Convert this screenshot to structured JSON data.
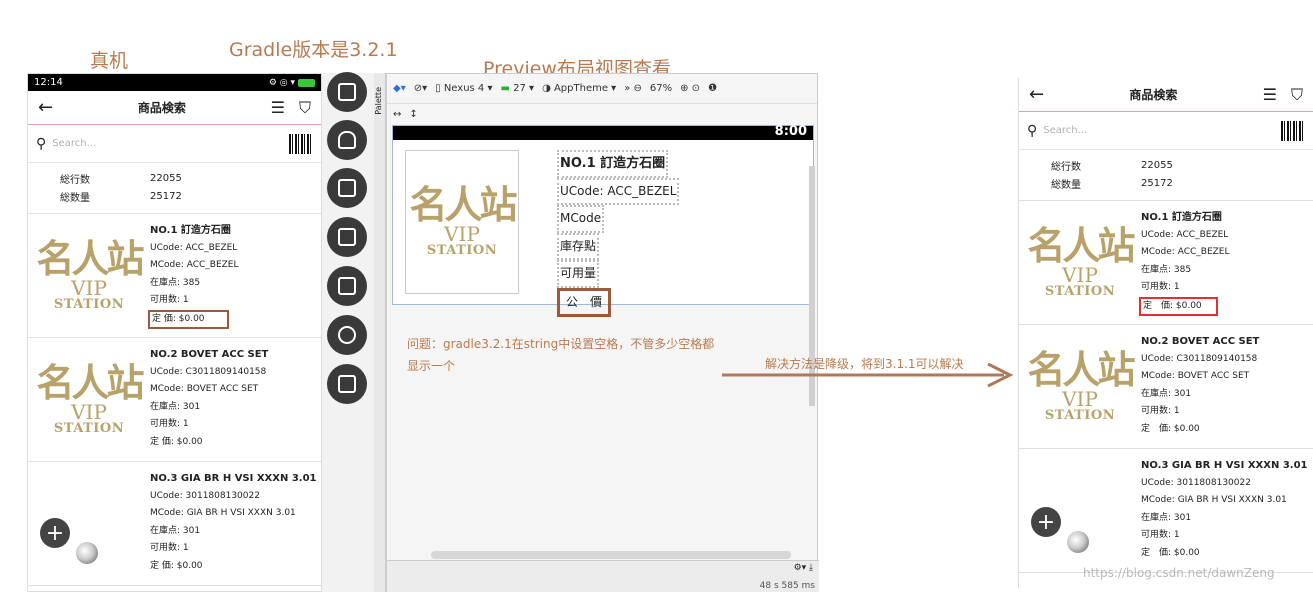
{
  "annotations": {
    "real_device": "真机",
    "gradle_version": "Gradle版本是3.2.1",
    "preview": "Preview布局视图查看",
    "problem_line1": "问题：gradle3.2.1在string中设置空格，不管多少空格都",
    "problem_line2": "显示一个",
    "solution": "解决方法是降级，将到3.1.1可以解决",
    "watermark": "https://blog.csdn.net/dawnZeng"
  },
  "status_bar": {
    "time": "12:14",
    "right": "⚙ ◎ ▾"
  },
  "app": {
    "title": "商品検索",
    "search_placeholder": "Search...",
    "totals": [
      {
        "label": "総行数",
        "value": "22055"
      },
      {
        "label": "総数量",
        "value": "25172"
      }
    ]
  },
  "logo": {
    "top": "名人站",
    "mid": "VIP",
    "bottom": "STATION"
  },
  "left_items": [
    {
      "name": "NO.1 訂造方石圈",
      "ucode": "UCode: ACC_BEZEL",
      "mcode": "MCode: ACC_BEZEL",
      "stock": "在庫点: 385",
      "avail": "可用数: 1",
      "price": "定 価: $0.00"
    },
    {
      "name": "NO.2 BOVET ACC SET",
      "ucode": "UCode: C3011809140158",
      "mcode": "MCode: BOVET ACC SET",
      "stock": "在庫点: 301",
      "avail": "可用数: 1",
      "price": "定 価: $0.00"
    },
    {
      "name": "NO.3 GIA BR H VSI XXXN 3.01",
      "ucode": "UCode: 3011808130022",
      "mcode": "MCode: GIA BR H VSI XXXN 3.01",
      "stock": "在庫点: 301",
      "avail": "可用数: 1",
      "price": "定 価: $0.00"
    }
  ],
  "right_items": [
    {
      "name": "NO.1 訂造方石圈",
      "ucode": "UCode: ACC_BEZEL",
      "mcode": "MCode: ACC_BEZEL",
      "stock": "在庫点: 385",
      "avail": "可用数: 1",
      "price": "定　価: $0.00"
    },
    {
      "name": "NO.2 BOVET ACC SET",
      "ucode": "UCode: C3011809140158",
      "mcode": "MCode: BOVET ACC SET",
      "stock": "在庫点: 301",
      "avail": "可用数: 1",
      "price": "定　価: $0.00"
    },
    {
      "name": "NO.3 GIA BR H VSI XXXN 3.01",
      "ucode": "UCode: 3011808130022",
      "mcode": "MCode: GIA BR H VSI XXXN 3.01",
      "stock": "在庫点: 301",
      "avail": "可用数: 1",
      "price": "定　価: $0.00"
    }
  ],
  "studio": {
    "palette_label": "Palette",
    "device": "Nexus 4",
    "api": "27",
    "theme": "AppTheme",
    "zoom": "67%",
    "preview_time": "8:00",
    "preview_name": "NO.1 訂造方石圈",
    "preview_ucode_label": "UCode:",
    "preview_ucode_value": "ACC_BEZEL",
    "preview_mcode": "MCode",
    "preview_stock": "庫存點",
    "preview_avail": "可用量",
    "preview_price": "公　價",
    "render_time": "48 s 585 ms"
  },
  "colors": {
    "annotation": "#b97a4f",
    "highlight_brown": "#9c5a3a",
    "highlight_red": "#e03030",
    "logo_gold": "#b8a26a"
  }
}
